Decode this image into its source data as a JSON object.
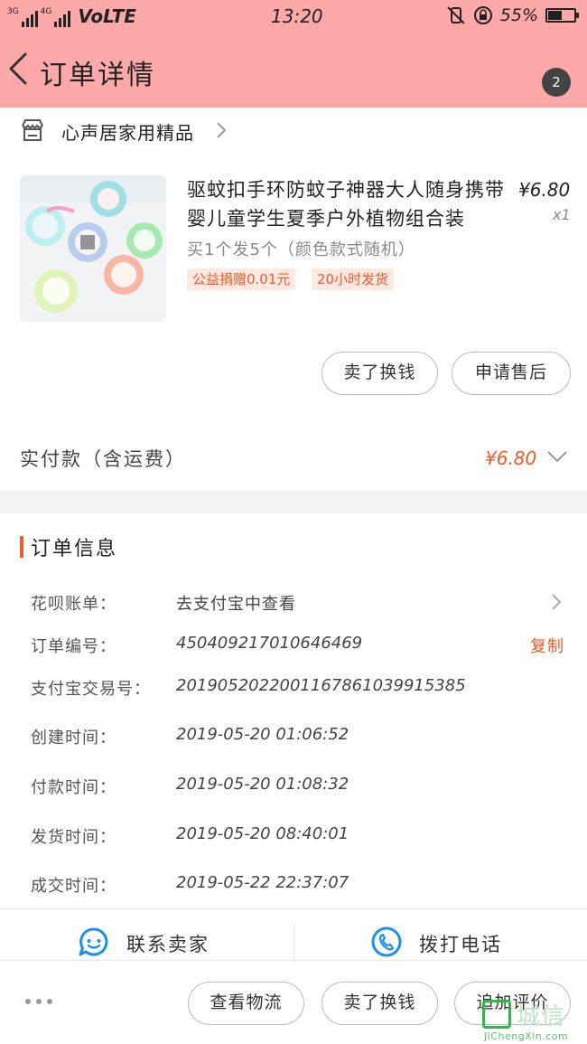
{
  "status_bar": {
    "net1": "3G",
    "net2": "4G",
    "volte": "VoLTE",
    "time": "13:20",
    "battery": "55%",
    "battery_level": 0.55
  },
  "header": {
    "title": "订单详情",
    "badge_count": "2"
  },
  "store": {
    "name": "心声居家用精品"
  },
  "product": {
    "title": "驱蚊扣手环防蚊子神器大人随身携带婴儿童学生夏季户外植物组合装",
    "price": "¥6.80",
    "quantity": "x1",
    "spec": "买1个发5个（颜色款式随机）",
    "tags": [
      "公益捐赠0.01元",
      "20小时发货"
    ]
  },
  "product_actions": {
    "resell": "卖了换钱",
    "after_sale": "申请售后"
  },
  "total": {
    "label": "实付款（含运费）",
    "value": "¥6.80"
  },
  "order_info": {
    "title": "订单信息",
    "rows": [
      {
        "label": "花呗账单：",
        "value": "去支付宝中查看"
      },
      {
        "label": "订单编号：",
        "value": "450409217010646469"
      },
      {
        "label": "支付宝交易号：",
        "value": "2019052022001167861039915385"
      },
      {
        "label": "创建时间：",
        "value": "2019-05-20 01:06:52"
      },
      {
        "label": "付款时间：",
        "value": "2019-05-20 01:08:32"
      },
      {
        "label": "发货时间：",
        "value": "2019-05-20 08:40:01"
      },
      {
        "label": "成交时间：",
        "value": "2019-05-22 22:37:07"
      }
    ],
    "copy_label": "复制"
  },
  "contact": {
    "seller": "联系卖家",
    "call": "拨打电话"
  },
  "bottom_bar": {
    "logistics": "查看物流",
    "resell": "卖了换钱",
    "review": "追加评价"
  },
  "watermark": {
    "cn": "城信",
    "en": "JiChengXin.com"
  },
  "colors": {
    "header_bg": "#fda9a9",
    "accent": "#f05a28",
    "tag_bg": "#fde9e2",
    "icon_blue": "#1e90e8"
  }
}
